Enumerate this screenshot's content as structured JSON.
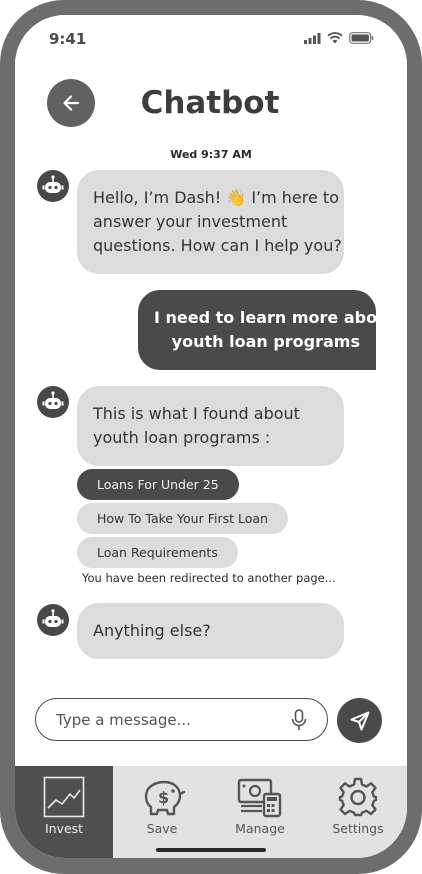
{
  "status_bar": {
    "time": "9:41"
  },
  "header": {
    "title": "Chatbot",
    "back_icon": "arrow-left-icon"
  },
  "chat": {
    "timestamp": "Wed 9:37 AM",
    "bot_greeting": [
      "Hello, I’m Dash! 👋 I’m here to",
      "answer your investment",
      "questions. How can I help you?"
    ],
    "user_message": [
      "I need to learn more about",
      "youth loan programs"
    ],
    "bot_found": [
      "This is what I found about",
      "youth loan programs :"
    ],
    "suggestions": [
      "Loans For Under 25",
      "How To Take Your First Loan",
      "Loan Requirements"
    ],
    "selected_suggestion": "Loans For Under 25",
    "redirect_notice": "You have been redirected to another page...",
    "bot_followup": "Anything else?"
  },
  "composer": {
    "placeholder": "Type a message...",
    "mic_icon": "microphone-icon",
    "send_icon": "send-icon"
  },
  "tabbar": {
    "active": "Invest",
    "tabs": [
      {
        "label": "Invest",
        "icon": "chart-icon"
      },
      {
        "label": "Save",
        "icon": "piggy-bank-icon"
      },
      {
        "label": "Manage",
        "icon": "money-calculator-icon"
      },
      {
        "label": "Settings",
        "icon": "gear-icon"
      }
    ]
  },
  "colors": {
    "dark": "#4a4a4a",
    "bubble": "#dcdcdc",
    "frame": "#6d6d6d"
  }
}
